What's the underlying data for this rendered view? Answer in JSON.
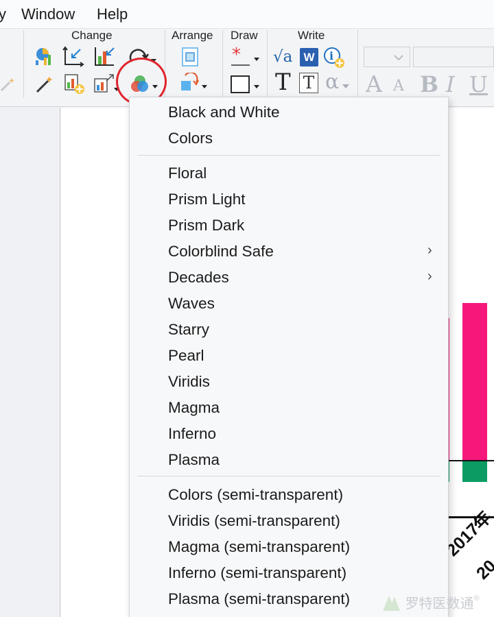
{
  "menubar": {
    "view_fragment": "y",
    "window": "Window",
    "help": "Help"
  },
  "toolbar": {
    "groups": {
      "change": "Change",
      "arrange": "Arrange",
      "draw": "Draw",
      "write": "Write"
    },
    "icons": [
      "chart-icon",
      "axes-icon",
      "bar-chart-icon",
      "redo-icon",
      "magic-wand-icon",
      "add-data-icon",
      "resize-chart-icon",
      "color-scheme-icon",
      "arrange-icon",
      "rotate-shape-icon",
      "asterisk-icon",
      "rectangle-icon",
      "sqrt-icon",
      "word-icon",
      "info-add-icon",
      "text-icon",
      "text-box-icon",
      "alpha-icon",
      "font-larger-icon",
      "font-smaller-icon",
      "bold-icon",
      "italic-icon",
      "underline-icon"
    ],
    "symbols": {
      "sqrt": "√a",
      "word": "W",
      "info": "i",
      "text": "T",
      "alpha": "α",
      "bold": "B",
      "italic": "I",
      "underline": "U",
      "a": "A"
    }
  },
  "color_scheme_menu": {
    "sections": [
      {
        "items": [
          {
            "label": "Black and White"
          },
          {
            "label": "Colors"
          }
        ]
      },
      {
        "items": [
          {
            "label": "Floral"
          },
          {
            "label": "Prism Light"
          },
          {
            "label": "Prism Dark"
          },
          {
            "label": "Colorblind Safe",
            "submenu": "›"
          },
          {
            "label": "Decades",
            "submenu": "›"
          },
          {
            "label": "Waves"
          },
          {
            "label": "Starry"
          },
          {
            "label": "Pearl"
          },
          {
            "label": "Viridis"
          },
          {
            "label": "Magma"
          },
          {
            "label": "Inferno"
          },
          {
            "label": "Plasma"
          }
        ]
      },
      {
        "items": [
          {
            "label": "Colors (semi-transparent)"
          },
          {
            "label": "Viridis (semi-transparent)"
          },
          {
            "label": "Magma (semi-transparent)"
          },
          {
            "label": "Inferno (semi-transparent)"
          },
          {
            "label": "Plasma (semi-transparent)"
          }
        ]
      }
    ]
  },
  "chart_fragment": {
    "tick_label": "2017年",
    "tick_label_next": "20",
    "colors": {
      "bar_pink": "#f5177a",
      "bar_green": "#0c9c63"
    }
  },
  "watermark": {
    "text": "罗特医数通",
    "mark": "®"
  },
  "colors": {
    "highlight": "#e0242d"
  }
}
